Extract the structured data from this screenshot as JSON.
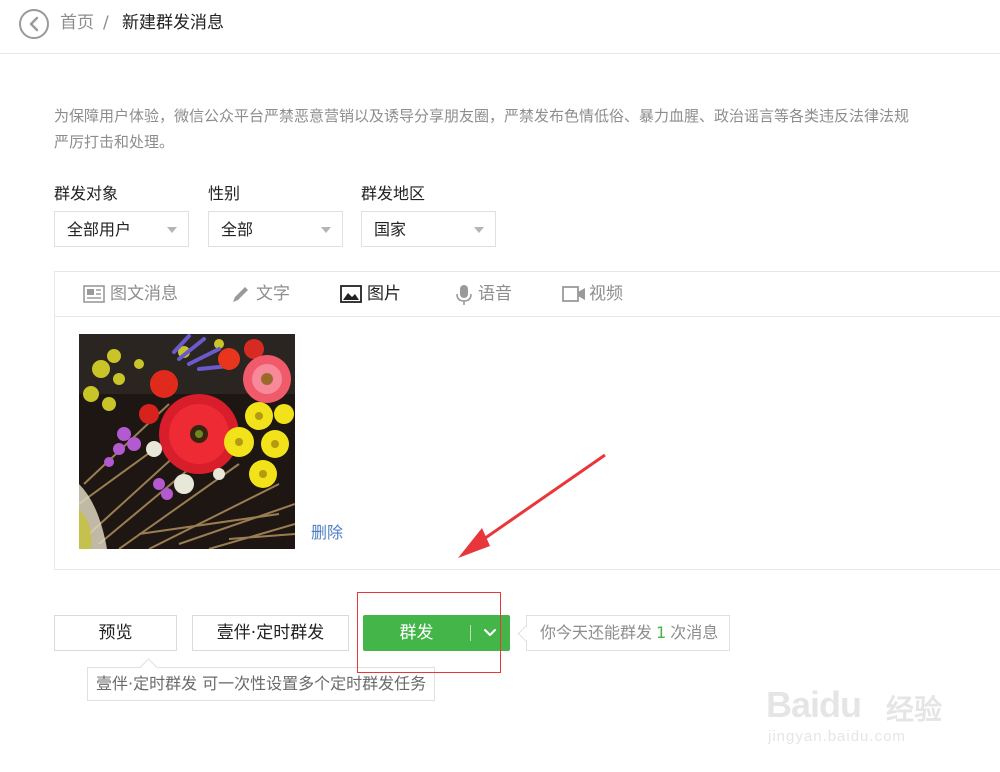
{
  "header": {
    "home_label": "首页",
    "separator": "/",
    "page_title": "新建群发消息"
  },
  "notice": {
    "text": "为保障用户体验，微信公众平台严禁恶意营销以及诱导分享朋友圈，严禁发布色情低俗、暴力血腥、政治谣言等各类违反法律法规",
    "text_line2": "严厉打击和处理。"
  },
  "filters": [
    {
      "label": "群发对象",
      "value": "全部用户"
    },
    {
      "label": "性别",
      "value": "全部"
    },
    {
      "label": "群发地区",
      "value": "国家"
    }
  ],
  "editor": {
    "tabs": [
      {
        "label": "图文消息",
        "icon": "news-icon",
        "active": false
      },
      {
        "label": "文字",
        "icon": "pencil-icon",
        "active": false
      },
      {
        "label": "图片",
        "icon": "image-icon",
        "active": true
      },
      {
        "label": "语音",
        "icon": "microphone-icon",
        "active": false
      },
      {
        "label": "视频",
        "icon": "video-icon",
        "active": false
      }
    ],
    "delete_label": "删除"
  },
  "actions": {
    "preview_label": "预览",
    "schedule_label": "壹伴·定时群发",
    "send_label": "群发",
    "quota_prefix": "你今天还能群发",
    "quota_count": "1",
    "quota_suffix": "次消息",
    "tooltip": "壹伴·定时群发 可一次性设置多个定时群发任务"
  },
  "watermark": {
    "brand": "Baidu",
    "brand_cn": "经验",
    "url": "jingyan.baidu.com"
  },
  "colors": {
    "primary_green": "#44b549",
    "link_blue": "#4e7fc4",
    "annotation_red": "#e8373a"
  }
}
